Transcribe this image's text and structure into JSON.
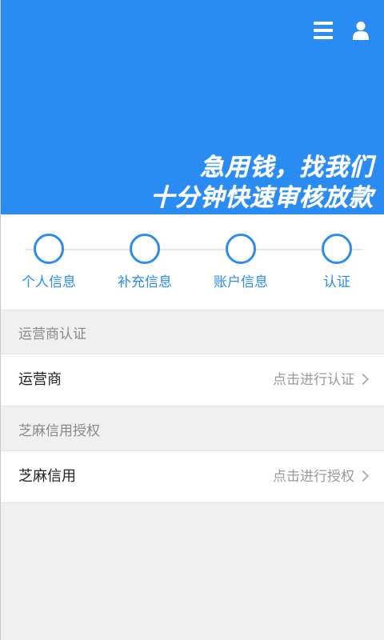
{
  "header": {
    "slogan_line1": "急用钱，找我们",
    "slogan_line2": "十分钟快速审核放款",
    "menu_icon": "menu-icon",
    "user_icon": "user-icon",
    "background_color": "#2a8bf2"
  },
  "steps": {
    "items": [
      {
        "label": "个人信息"
      },
      {
        "label": "补充信息"
      },
      {
        "label": "账户信息"
      },
      {
        "label": "认证"
      }
    ],
    "accent_color": "#2a8bf2"
  },
  "sections": [
    {
      "title": "运营商认证",
      "row_label": "运营商",
      "row_action": "点击进行认证"
    },
    {
      "title": "芝麻信用授权",
      "row_label": "芝麻信用",
      "row_action": "点击进行授权"
    }
  ]
}
